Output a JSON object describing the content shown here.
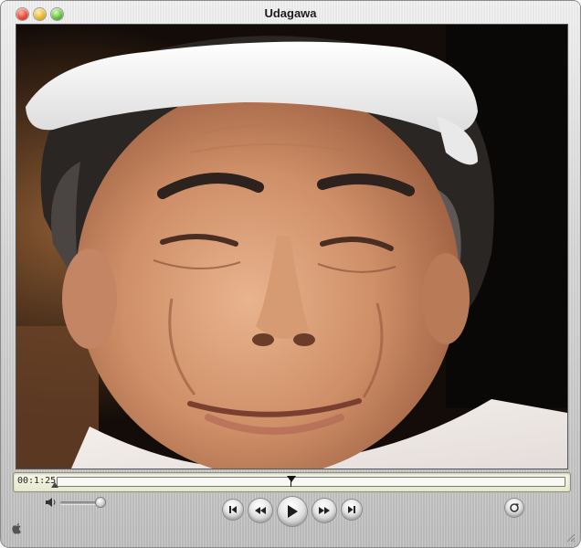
{
  "window": {
    "title": "Udagawa"
  },
  "timeline": {
    "timecode": "00:1:25",
    "position_fraction": 0.46
  },
  "volume": {
    "level_fraction": 0.95
  },
  "icons": {
    "close": "close-icon",
    "minimize": "minimize-icon",
    "zoom": "zoom-icon",
    "volume": "speaker-icon",
    "to_start": "skip-to-start-icon",
    "rewind": "rewind-icon",
    "play": "play-icon",
    "fast_forward": "fast-forward-icon",
    "to_end": "skip-to-end-icon",
    "loop": "loop-icon",
    "apple": "apple-icon",
    "resize": "resize-grip-icon"
  },
  "colors": {
    "timeline_bg": "#efefdb",
    "chrome": "#d0d0d0",
    "close_button": "#e0432c",
    "minimize_button": "#e6b12a",
    "zoom_button": "#5fb63a"
  }
}
